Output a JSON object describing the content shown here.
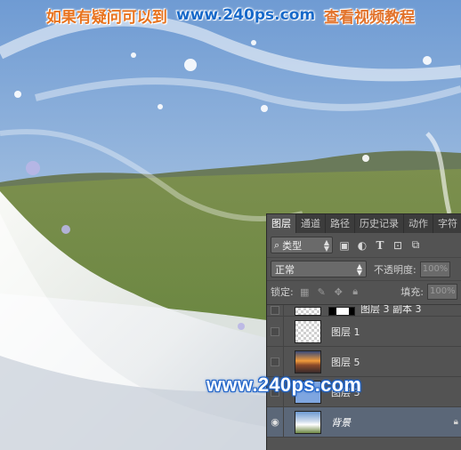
{
  "banner": {
    "left_text": "如果有疑问可以到",
    "url": "www.240ps.com",
    "right_text": "查看视频教程"
  },
  "watermark": "www.240ps.com",
  "panel": {
    "tabs": [
      "图层",
      "通道",
      "路径",
      "历史记录",
      "动作",
      "字符"
    ],
    "active_tab": "图层",
    "filter_label": "类型",
    "blend_mode": "正常",
    "opacity_label": "不透明度:",
    "opacity_value": "100%",
    "lock_label": "锁定:",
    "fill_label": "填充:",
    "fill_value": "100%",
    "layers": [
      {
        "name": "图层 3 副本 3",
        "visible": false,
        "partial": true
      },
      {
        "name": "图层 1",
        "visible": false
      },
      {
        "name": "图层 5",
        "visible": false
      },
      {
        "name": "图层 3",
        "visible": false
      },
      {
        "name": "背景",
        "visible": true,
        "selected": true,
        "locked": true
      }
    ]
  },
  "colors": {
    "panel_bg": "#535353",
    "tab_bar_bg": "#3c3c3c",
    "banner_orange": "#e8731e",
    "banner_blue": "#1769c9",
    "watermark_outline": "#1f63c8"
  }
}
